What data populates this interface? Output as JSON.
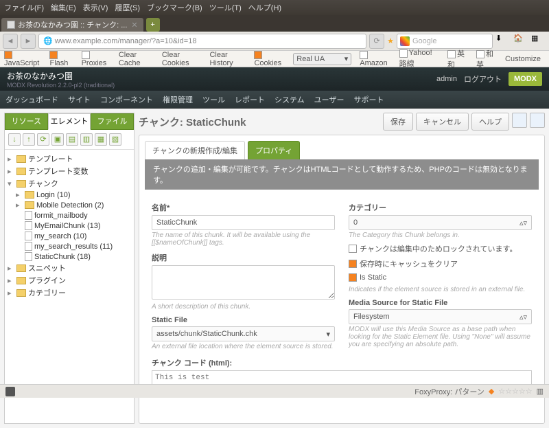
{
  "menu": {
    "file": "ファイル(F)",
    "edit": "編集(E)",
    "view": "表示(V)",
    "history": "履歴(S)",
    "bookmarks": "ブックマーク(B)",
    "tools": "ツール(T)",
    "help": "ヘルプ(H)"
  },
  "browsertab": {
    "title": "お茶のなかみつ園 :: チャンク: ..."
  },
  "url": "www.example.com/manager/?a=10&id=18",
  "search": {
    "placeholder": "Google"
  },
  "devbar": {
    "js": "JavaScript",
    "flash": "Flash",
    "proxies": "Proxies",
    "cc": "Clear Cache",
    "cco": "Clear Cookies",
    "ch": "Clear History",
    "cookies": "Cookies",
    "ua": "Real UA",
    "amazon": "Amazon",
    "yahoo": "Yahoo!路線",
    "eiwa": "英和",
    "waei": "和英",
    "cust": "Customize"
  },
  "brand": {
    "title": "お茶のなかみつ園",
    "sub": "MODX Revolution 2.2.0-pl2 (traditional)"
  },
  "toplinks": {
    "admin": "admin",
    "logout": "ログアウト",
    "logo": "MODX"
  },
  "nav": {
    "dash": "ダッシュボード",
    "site": "サイト",
    "comp": "コンポーネント",
    "perm": "権限管理",
    "tool": "ツール",
    "report": "レポート",
    "system": "システム",
    "user": "ユーザー",
    "support": "サポート"
  },
  "sidetabs": {
    "res": "リソース",
    "elm": "エレメント",
    "file": "ファイル"
  },
  "tree": {
    "tpl": "テンプレート",
    "tplvar": "テンプレート変数",
    "chunk": "チャンク",
    "login": "Login (10)",
    "mobile": "Mobile Detection (2)",
    "formit": "formit_mailbody",
    "myemail": "MyEmailChunk (13)",
    "mysearch": "my_search (10)",
    "myresults": "my_search_results (11)",
    "static": "StaticChunk (18)",
    "snippet": "スニペット",
    "plugin": "プラグイン",
    "category": "カテゴリー"
  },
  "page": {
    "title": "チャンク: StaticChunk"
  },
  "actions": {
    "save": "保存",
    "cancel": "キャンセル",
    "help": "ヘルプ"
  },
  "ptabs": {
    "edit": "チャンクの新規作成/編集",
    "prop": "プロパティ"
  },
  "desc": "チャンクの追加・編集が可能です。チャンクはHTMLコードとして動作するため、PHPのコードは無効となります。",
  "form": {
    "name_lbl": "名前*",
    "name_val": "StaticChunk",
    "name_help": "The name of this chunk. It will be available using the [[$nameOfChunk]] tags.",
    "desc_lbl": "説明",
    "desc_val": "",
    "desc_help": "A short description of this chunk.",
    "static_lbl": "Static File",
    "static_val": "assets/chunk/StaticChunk.chk",
    "static_help": "An external file location where the element source is stored.",
    "cat_lbl": "カテゴリー",
    "cat_val": "0",
    "cat_help": "The Category this Chunk belongs in.",
    "lock": "チャンクは編集中のためロックされています。",
    "cache": "保存時にキャッシュをクリア",
    "isstatic": "Is Static",
    "isstatic_help": "Indicates if the element source is stored in an external file.",
    "media_lbl": "Media Source for Static File",
    "media_val": "Filesystem",
    "media_help": "MODX will use this Media Source as a base path when looking for the Static Element file. Using \"None\" will assume you are specifying an absolute path.",
    "code_lbl": "チャンク コード (html):",
    "code_val": "This is test"
  },
  "status": {
    "foxy": "FoxyProxy: パターン"
  }
}
